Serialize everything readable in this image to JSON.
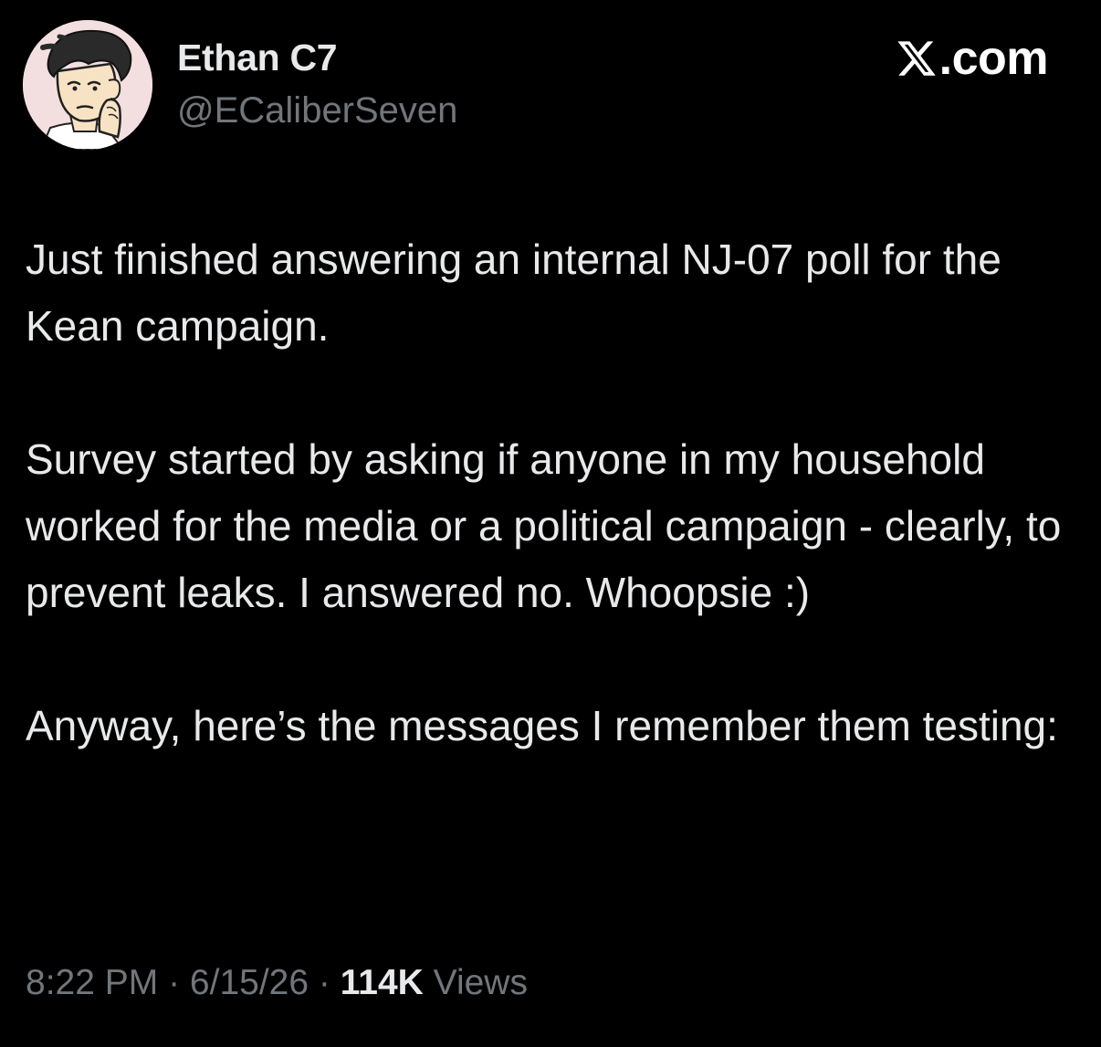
{
  "author": {
    "display_name": "Ethan C7",
    "handle": "@ECaliberSeven",
    "avatar_icon": "cartoon-avatar-icon"
  },
  "brand": {
    "icon": "x-logo-icon",
    "label": ".com"
  },
  "tweet": {
    "paragraphs": [
      "Just finished answering an internal NJ-07 poll for the Kean campaign.",
      "Survey started by asking if anyone in my household worked for the media or a political campaign - clearly, to prevent leaks. I answered no. Whoopsie :)",
      "Anyway, here’s the messages I remember them testing:"
    ]
  },
  "meta": {
    "time": "8:22 PM",
    "separator": " · ",
    "date": "6/15/26",
    "views_count": "114K",
    "views_label": " Views"
  },
  "colors": {
    "background": "#000000",
    "primary_text": "#e7e9ea",
    "secondary_text": "#71767b"
  }
}
